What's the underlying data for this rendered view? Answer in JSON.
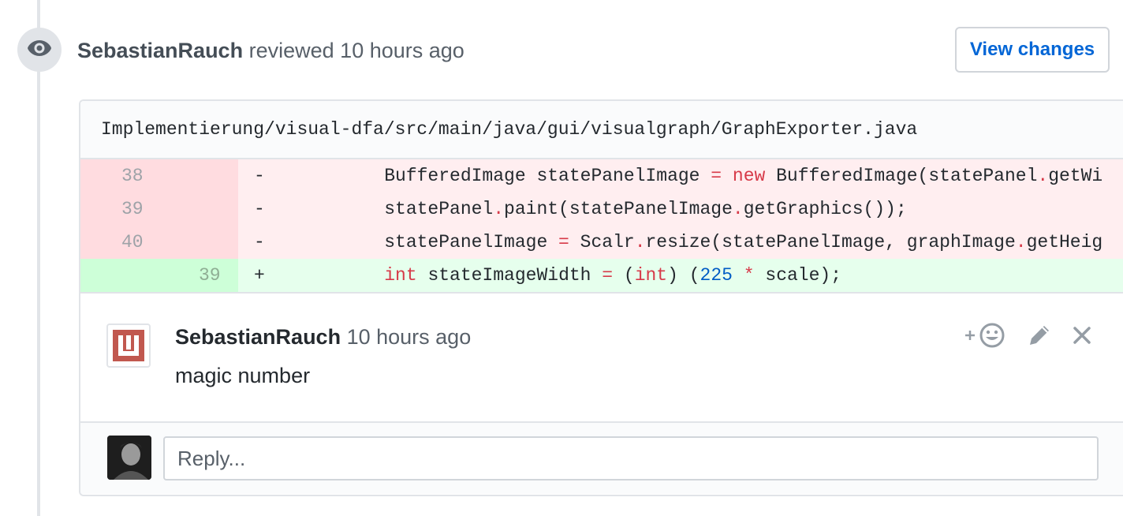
{
  "review": {
    "author": "SebastianRauch",
    "action": "reviewed",
    "time": "10 hours ago",
    "view_changes_label": "View changes",
    "icon": "eye-icon"
  },
  "file": {
    "path": "Implementierung/visual-dfa/src/main/java/gui/visualgraph/GraphExporter.java"
  },
  "diff": {
    "lines": [
      {
        "type": "del",
        "old": "38",
        "new": "",
        "marker": "-",
        "code": "BufferedImage statePanelImage = new BufferedImage(statePanel.getWi"
      },
      {
        "type": "del",
        "old": "39",
        "new": "",
        "marker": "-",
        "code": "statePanel.paint(statePanelImage.getGraphics());"
      },
      {
        "type": "del",
        "old": "40",
        "new": "",
        "marker": "-",
        "code": "statePanelImage = Scalr.resize(statePanelImage, graphImage.getHeig"
      },
      {
        "type": "add",
        "old": "",
        "new": "39",
        "marker": "+",
        "code": "int stateImageWidth = (int) (225 * scale);"
      }
    ]
  },
  "comment": {
    "author": "SebastianRauch",
    "time": "10 hours ago",
    "body": "magic number",
    "reaction_icon": "add-reaction-icon",
    "edit_icon": "pencil-icon",
    "delete_icon": "close-icon"
  },
  "reply": {
    "placeholder": "Reply..."
  },
  "colors": {
    "link": "#0366d6",
    "deleted_bg": "#ffeef0",
    "added_bg": "#e6ffed",
    "keyword": "#d73a49",
    "number": "#005cc5"
  }
}
